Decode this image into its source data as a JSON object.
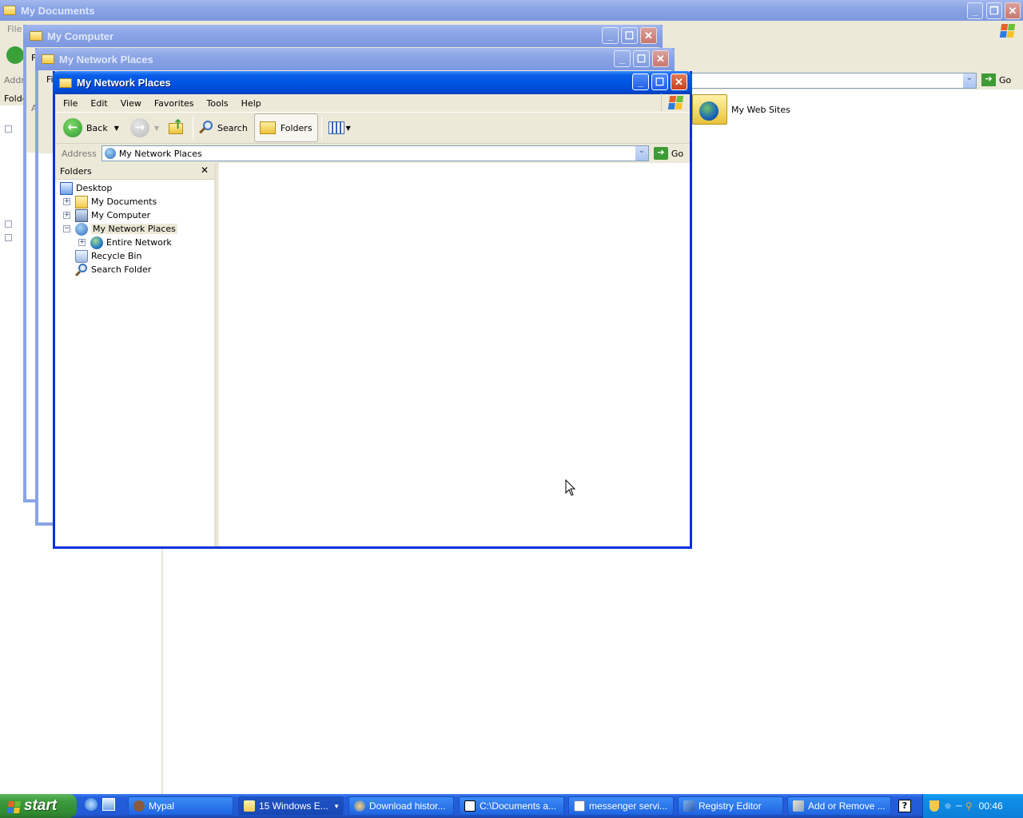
{
  "windows": {
    "my_documents": {
      "title": "My Documents",
      "menu_file": "File",
      "address_label": "Addr",
      "folders_label": "Folde",
      "go_label": "Go",
      "items": [
        {
          "label": "My Web Sites"
        }
      ]
    },
    "my_computer": {
      "title": "My Computer",
      "menu_file": "F",
      "address_label": "Ad",
      "folders_label": "Fo"
    },
    "net_places_back": {
      "title": "My Network Places",
      "menu_file": "Fi"
    },
    "net_places_front": {
      "title": "My Network Places",
      "menu": [
        "File",
        "Edit",
        "View",
        "Favorites",
        "Tools",
        "Help"
      ],
      "toolbar": {
        "back": "Back",
        "search": "Search",
        "folders": "Folders"
      },
      "address": {
        "label": "Address",
        "value": "My Network Places",
        "go": "Go"
      },
      "folders_pane": {
        "title": "Folders",
        "tree": [
          {
            "label": "Desktop",
            "icon": "desktop-icon",
            "expander": ""
          },
          {
            "label": "My Documents",
            "icon": "my-documents-icon",
            "expander": "+"
          },
          {
            "label": "My Computer",
            "icon": "my-computer-icon",
            "expander": "+"
          },
          {
            "label": "My Network Places",
            "icon": "network-places-icon",
            "expander": "−"
          },
          {
            "label": "Entire Network",
            "icon": "globe-icon",
            "expander": "+"
          },
          {
            "label": "Recycle Bin",
            "icon": "recycle-bin-icon",
            "expander": ""
          },
          {
            "label": "Search Folder",
            "icon": "search-folder-icon",
            "expander": ""
          }
        ]
      }
    }
  },
  "taskbar": {
    "start": "start",
    "tasks": [
      {
        "label": "Mypal",
        "icon": "mypal-icon"
      },
      {
        "label": "15 Windows E...",
        "icon": "folder-icon"
      },
      {
        "label": "Download histor...",
        "icon": "browser-icon"
      },
      {
        "label": "C:\\Documents a...",
        "icon": "7zip-icon"
      },
      {
        "label": "messenger servi...",
        "icon": "document-icon"
      },
      {
        "label": "Registry Editor",
        "icon": "registry-icon"
      },
      {
        "label": "Add or Remove ...",
        "icon": "add-remove-icon"
      }
    ],
    "clock": "00:46"
  },
  "colors": {
    "taskbar": "#245edb",
    "start": "#3c9a3c",
    "title_active": "#0054e3",
    "tray": "#0f8fe8"
  }
}
